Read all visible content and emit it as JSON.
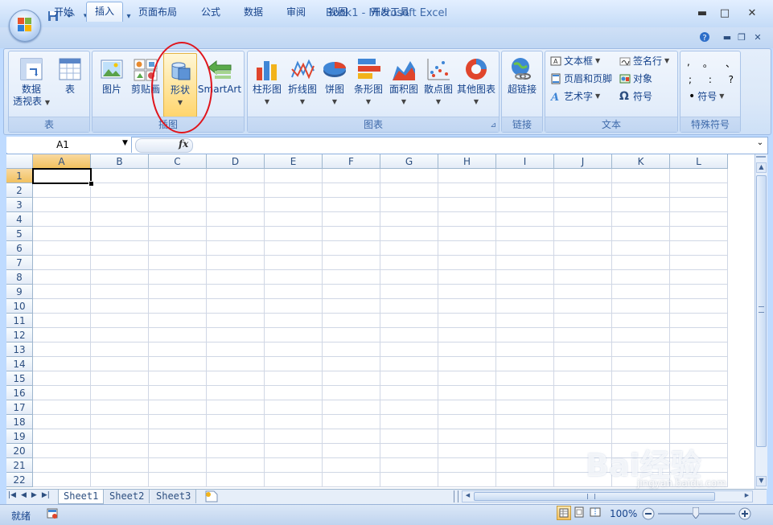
{
  "window": {
    "title": "Book1 - Microsoft Excel",
    "minimize": "▬",
    "maximize": "□",
    "close": "✕"
  },
  "qat": {
    "dropdown": "▾"
  },
  "tabs": [
    "开始",
    "插入",
    "页面布局",
    "公式",
    "数据",
    "审阅",
    "视图",
    "开发工具"
  ],
  "active_tab": "插入",
  "ribbon": {
    "groups": {
      "tables": {
        "label": "表",
        "pivot_line1": "数据",
        "pivot_line2": "透视表",
        "table": "表"
      },
      "illustrations": {
        "label": "插图",
        "picture": "图片",
        "clipart": "剪贴画",
        "shapes": "形状",
        "smartart": "SmartArt"
      },
      "charts": {
        "label": "图表",
        "items": [
          "柱形图",
          "折线图",
          "饼图",
          "条形图",
          "面积图",
          "散点图",
          "其他图表"
        ]
      },
      "links": {
        "label": "链接",
        "hyperlink": "超链接"
      },
      "text": {
        "label": "文本",
        "textbox": "文本框",
        "header_footer": "页眉和页脚",
        "wordart": "艺术字",
        "signature": "签名行",
        "object": "对象",
        "symbol": "符号"
      },
      "special": {
        "label": "特殊符号",
        "chars_row1": [
          ",",
          "。",
          "、"
        ],
        "chars_row2": [
          ";",
          ":",
          "?"
        ],
        "symbol": "符号"
      }
    }
  },
  "formula_bar": {
    "name_box": "A1",
    "fx": "fx"
  },
  "columns": [
    "A",
    "B",
    "C",
    "D",
    "E",
    "F",
    "G",
    "H",
    "I",
    "J",
    "K",
    "L"
  ],
  "rows": [
    "1",
    "2",
    "3",
    "4",
    "5",
    "6",
    "7",
    "8",
    "9",
    "10",
    "11",
    "12",
    "13",
    "14",
    "15",
    "16",
    "17",
    "18",
    "19",
    "20",
    "21",
    "22"
  ],
  "sheets": [
    "Sheet1",
    "Sheet2",
    "Sheet3"
  ],
  "active_sheet": "Sheet1",
  "status": {
    "ready": "就绪",
    "zoom": "100%"
  },
  "watermark": {
    "brand": "Bai经验",
    "url": "jingyan.baidu.com"
  },
  "colors": {
    "highlight_circle": "#e0151c",
    "active_tab_bg": "#ffffff",
    "ribbon_bg": "#dbe8f8"
  }
}
